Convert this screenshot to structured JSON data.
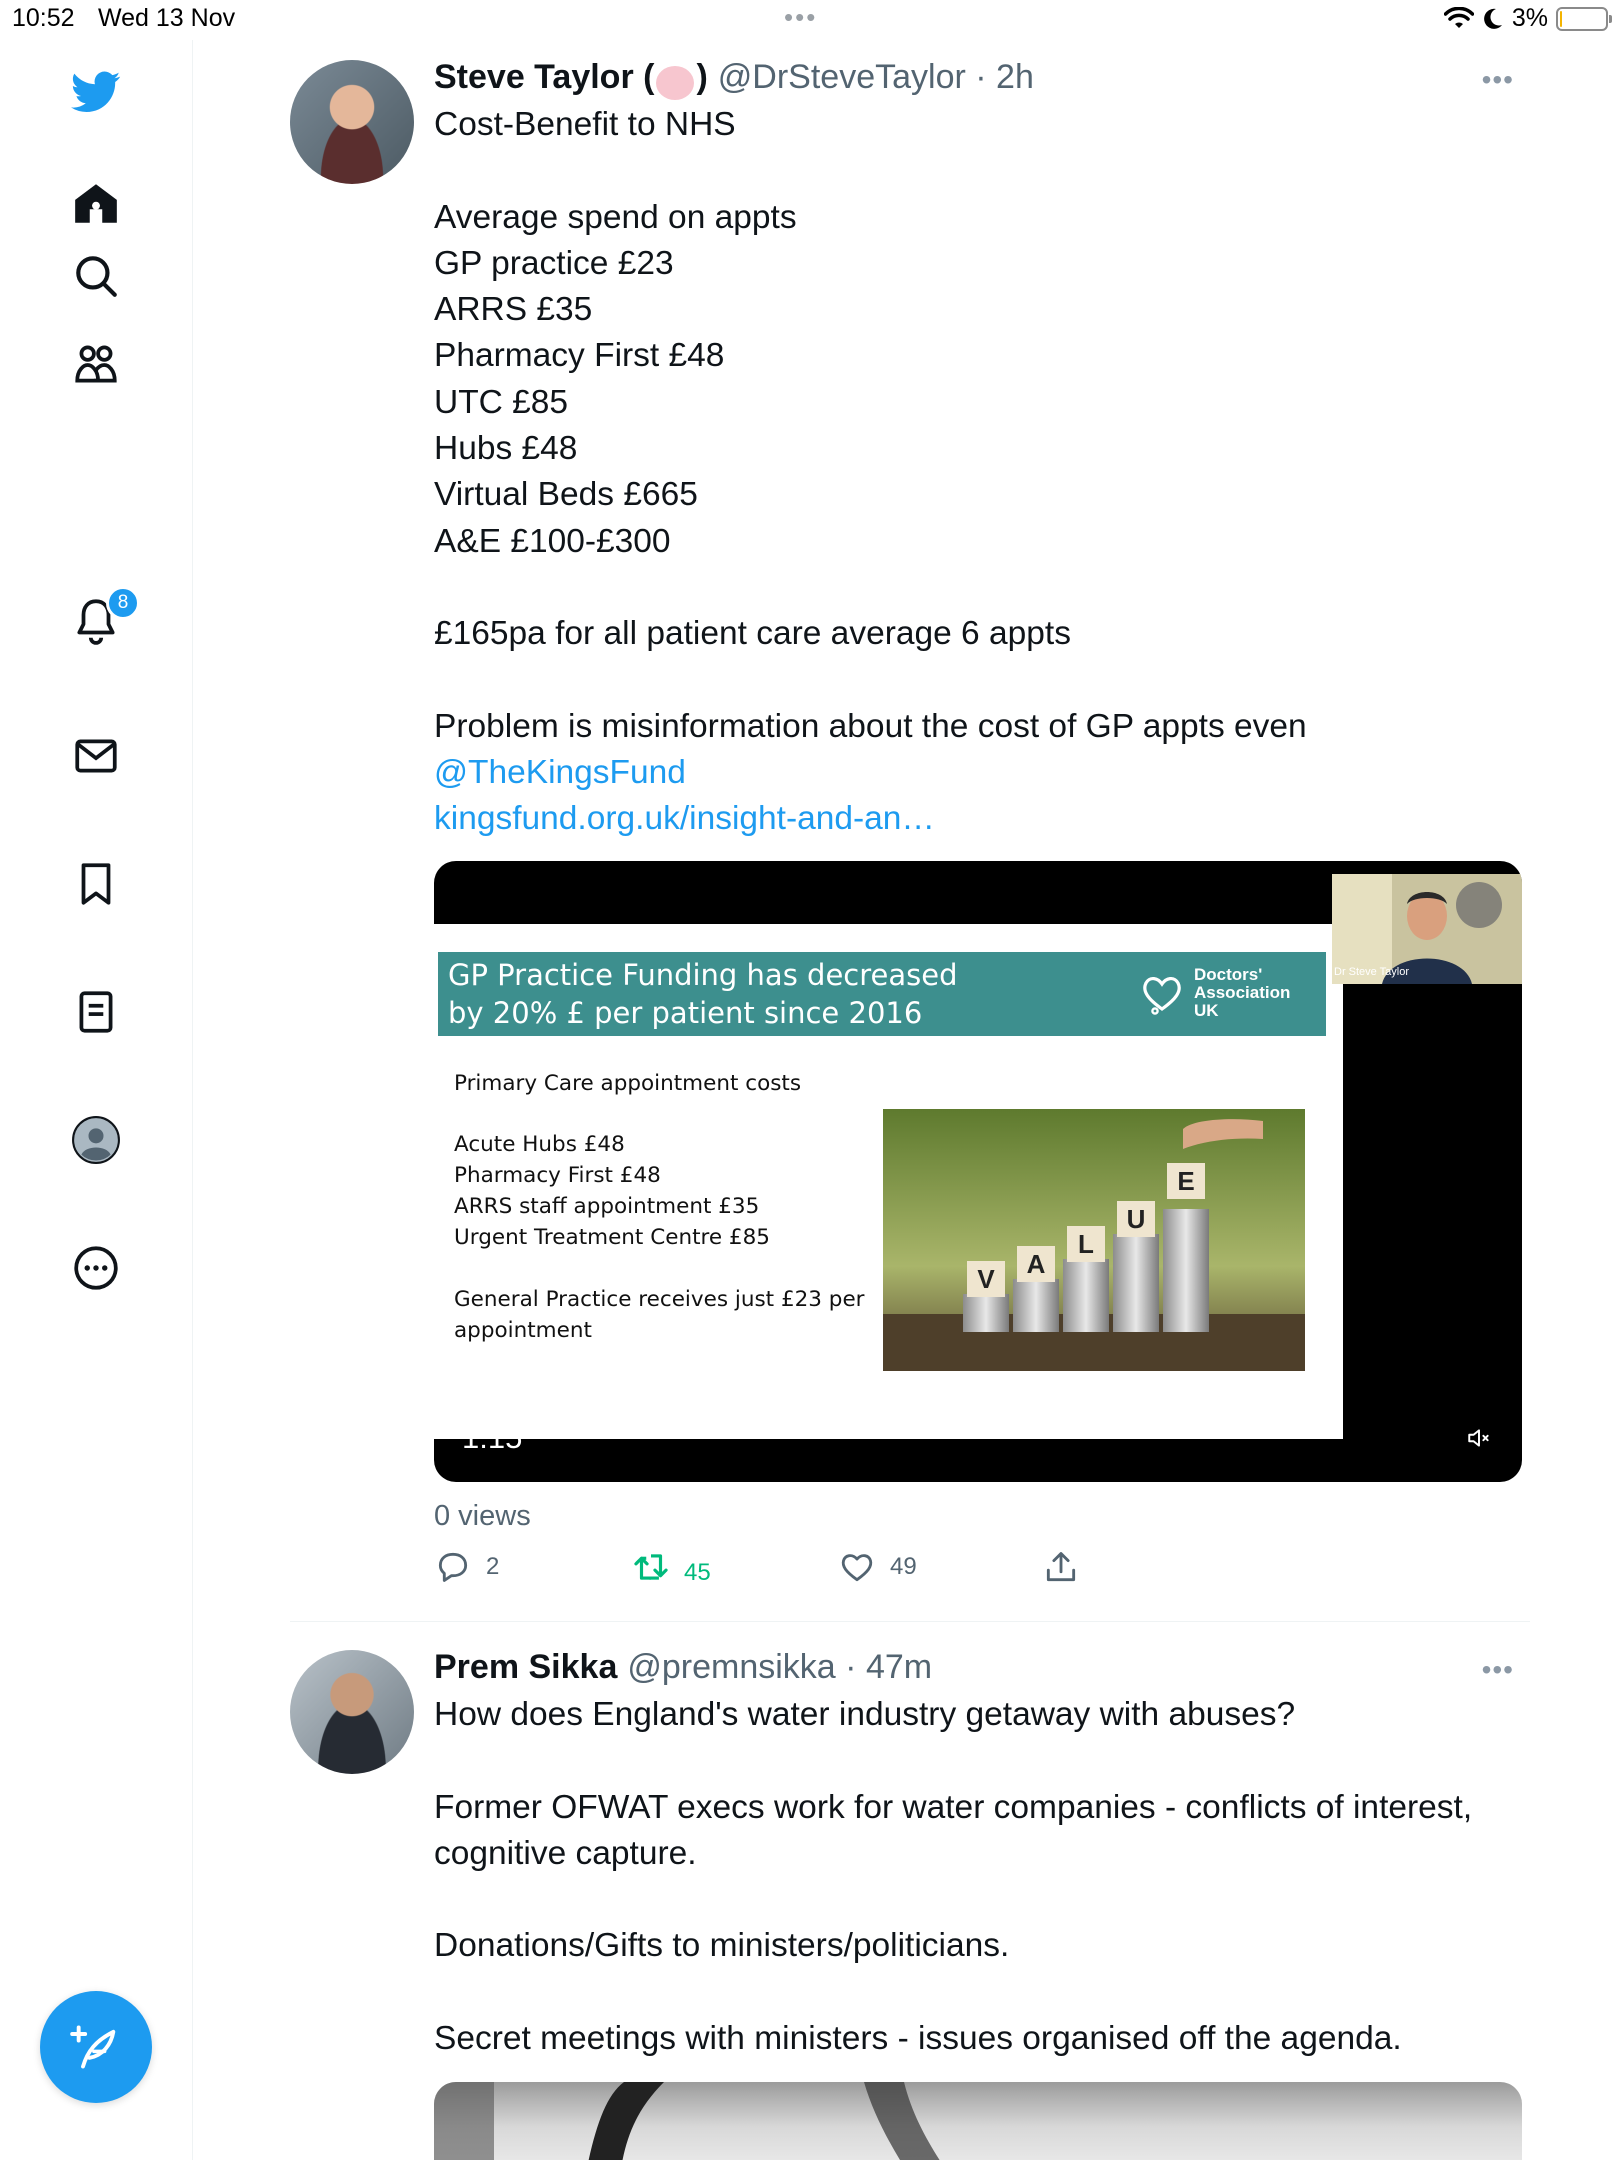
{
  "status_bar": {
    "time": "10:52",
    "date": "Wed 13 Nov",
    "battery": "3%",
    "battery_level": 0.03
  },
  "sidebar": {
    "items": [
      {
        "name": "home",
        "icon": "home-icon"
      },
      {
        "name": "explore",
        "icon": "search-icon"
      },
      {
        "name": "communities",
        "icon": "people-icon"
      },
      {
        "name": "notifications",
        "icon": "bell-icon",
        "badge": "8"
      },
      {
        "name": "messages",
        "icon": "envelope-icon"
      },
      {
        "name": "bookmarks",
        "icon": "bookmark-icon"
      },
      {
        "name": "lists",
        "icon": "list-icon"
      },
      {
        "name": "profile",
        "icon": "profile-avatar-icon"
      },
      {
        "name": "more",
        "icon": "more-circle-icon"
      }
    ],
    "compose_icon": "compose-feather-icon",
    "accent": "#1d9bf0"
  },
  "tweets": [
    {
      "name": "Steve Taylor (",
      "name_suffix": ")",
      "handle": "@DrSteveTaylor",
      "time": "2h",
      "more": "•••",
      "text": "Cost-Benefit to NHS\n\nAverage spend on appts\nGP practice £23\nARRS £35\nPharmacy First £48\nUTC £85\nHubs £48\nVirtual Beds £665\nA&E £100-£300\n\n£165pa for all patient care average 6 appts\n\nProblem is misinformation about the cost of GP appts even",
      "mention": "@TheKingsFund",
      "link": "kingsfund.org.uk/insight-and-an…",
      "video": {
        "slide_title": "GP Practice Funding has decreased\nby 20% £ per patient since 2016",
        "logo_text": "Doctors'\nAssociation\nUK",
        "heading": "Primary Care appointment costs",
        "list": "Acute Hubs £48\nPharmacy First £48\nARRS staff appointment £35\nUrgent Treatment Centre £85",
        "footer": "General Practice receives just £23 per\nappointment",
        "cam_label": "Dr Steve Taylor",
        "time": "1:15",
        "photo_letters": [
          "V",
          "A",
          "L",
          "U",
          "E"
        ]
      },
      "views": "0 views",
      "actions": {
        "replies": "2",
        "retweets": "45",
        "likes": "49"
      }
    },
    {
      "name": "Prem Sikka",
      "handle": "@premnsikka",
      "time": "47m",
      "more": "•••",
      "text": "How does England's water industry getaway with abuses?\n\nFormer OFWAT execs work for water companies - conflicts of interest, cognitive capture.\n\nDonations/Gifts to ministers/politicians.\n\nSecret meetings with ministers - issues organised off the agenda."
    }
  ]
}
